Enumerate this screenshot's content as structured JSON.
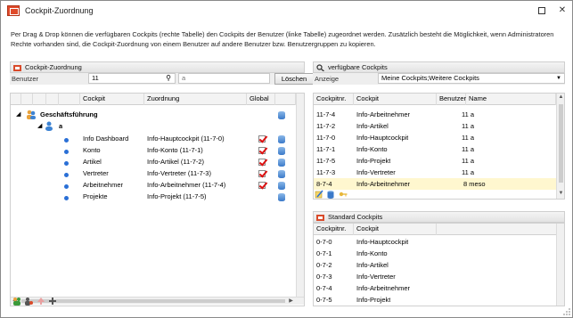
{
  "window": {
    "title": "Cockpit-Zuordnung",
    "description": "Per Drag & Drop können die verfügbaren Cockpits (rechte Tabelle) den Cockpits der Benutzer (linke Tabelle) zugeordnet werden. Zusätzlich besteht die Möglichkeit, wenn Administratoren Rechte vorhanden sind, die Cockpit-Zuordnung von einem Benutzer auf andere Benutzer bzw. Benutzergruppen zu kopieren."
  },
  "left_panel": {
    "header": "Cockpit-Zuordnung",
    "filter_label": "Benutzer",
    "user_value": "11",
    "user_name": "a",
    "delete_button": "Löschen",
    "columns": [
      "Cockpit",
      "Zuordnung",
      "Global"
    ],
    "tree": {
      "group": "Geschäftsführung",
      "user": "a"
    },
    "rows": [
      {
        "cockpit": "Info Dashboard",
        "zuordnung": "Info-Hauptcockpit (11-7-0)"
      },
      {
        "cockpit": "Konto",
        "zuordnung": "Info-Konto (11-7-1)"
      },
      {
        "cockpit": "Artikel",
        "zuordnung": "Info-Artikel (11-7-2)"
      },
      {
        "cockpit": "Vertreter",
        "zuordnung": "Info-Vertreter (11-7-3)"
      },
      {
        "cockpit": "Arbeitnehmer",
        "zuordnung": "Info-Arbeitnehmer (11-7-4)"
      },
      {
        "cockpit": "Projekte",
        "zuordnung": "Info-Projekt (11-7-5)"
      }
    ]
  },
  "right_panel": {
    "header": "verfügbare Cockpits",
    "filter_label": "Anzeige",
    "anzeige_value": "Meine Cockpits;Weitere Cockpits",
    "columns": [
      "Cockpitnr.",
      "Cockpit",
      "Benutzer",
      "Name"
    ],
    "rows": [
      {
        "nr": "11-7-4",
        "cockpit": "Info-Arbeitnehmer",
        "benutzer": "",
        "name": "11 a"
      },
      {
        "nr": "11-7-2",
        "cockpit": "Info-Artikel",
        "benutzer": "",
        "name": "11 a"
      },
      {
        "nr": "11-7-0",
        "cockpit": "Info-Hauptcockpit",
        "benutzer": "",
        "name": "11 a"
      },
      {
        "nr": "11-7-1",
        "cockpit": "Info-Konto",
        "benutzer": "",
        "name": "11 a"
      },
      {
        "nr": "11-7-5",
        "cockpit": "Info-Projekt",
        "benutzer": "",
        "name": "11 a"
      },
      {
        "nr": "11-7-3",
        "cockpit": "Info-Vertreter",
        "benutzer": "",
        "name": "11 a"
      },
      {
        "nr": "8-7-4",
        "cockpit": "Info-Arbeitnehmer",
        "benutzer": "",
        "name": "8 meso"
      }
    ]
  },
  "standard_panel": {
    "header": "Standard Cockpits",
    "columns": [
      "Cockpitnr.",
      "Cockpit"
    ],
    "rows": [
      {
        "nr": "0-7-0",
        "cockpit": "Info-Hauptcockpit"
      },
      {
        "nr": "0-7-1",
        "cockpit": "Info-Konto"
      },
      {
        "nr": "0-7-2",
        "cockpit": "Info-Artikel"
      },
      {
        "nr": "0-7-3",
        "cockpit": "Info-Vertreter"
      },
      {
        "nr": "0-7-4",
        "cockpit": "Info-Arbeitnehmer"
      },
      {
        "nr": "0-7-5",
        "cockpit": "Info-Projekt"
      }
    ]
  },
  "colors": {
    "accent": "#2a6fd6",
    "check": "#dd1111",
    "highlight_row": "#fff7cf"
  }
}
